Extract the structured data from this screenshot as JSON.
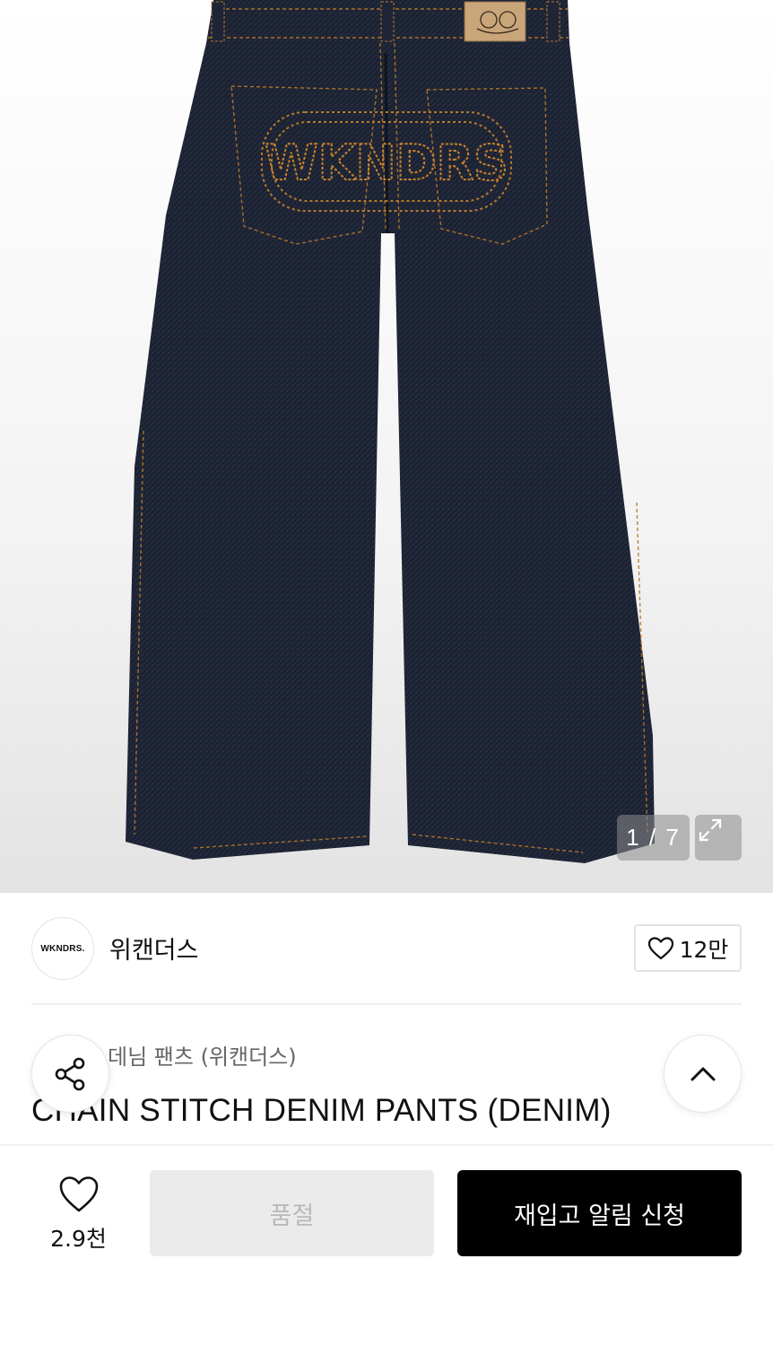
{
  "gallery": {
    "counter": "1 / 7",
    "image_alt": "",
    "stitch_logo_text": "WKNDRS"
  },
  "brand": {
    "logo_text": "WKNDRS.",
    "name": "위캔더스",
    "like_count": "12만"
  },
  "product": {
    "korean_name": "데님 팬츠 (위캔더스)",
    "title": "CHAIN STITCH DENIM PANTS (DENIM)"
  },
  "bottom_bar": {
    "wish_count": "2.9천",
    "soldout_label": "품절",
    "restock_label": "재입고 알림 신청"
  },
  "colors": {
    "denim": "#1b2233",
    "stitch": "#b8792a",
    "primary_button": "#000000",
    "disabled_button": "#ebebeb"
  },
  "icons": [
    "expand-icon",
    "heart-icon",
    "share-icon",
    "chevron-up-icon"
  ]
}
